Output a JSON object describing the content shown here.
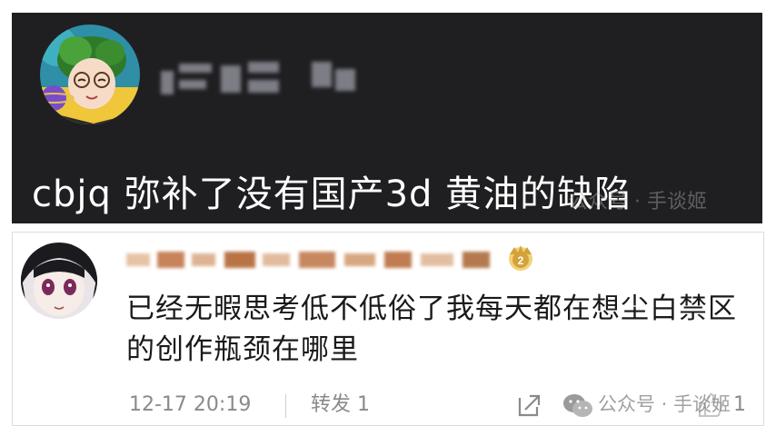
{
  "post": {
    "text": "cbjq 弥补了没有国产3d 黄油的缺陷",
    "watermark": "公众号 · 手谈姬"
  },
  "comment": {
    "text": "已经无暇思考低不低俗了我每天都在想尘白禁区的创作瓶颈在哪里",
    "timestamp": "12-17 20:19",
    "repost_label": "转发 1",
    "like_count": "1",
    "watermark": "公众号 · 手谈姬"
  },
  "icons": {
    "crown": "crown-badge-icon",
    "share": "share-icon",
    "wechat": "wechat-icon",
    "like": "like-thumb-icon"
  },
  "colors": {
    "dark_card": "#1f1f22",
    "text_light": "#ffffff",
    "meta_gray": "#8a8a8a",
    "crown_gold": "#d4a23a"
  }
}
